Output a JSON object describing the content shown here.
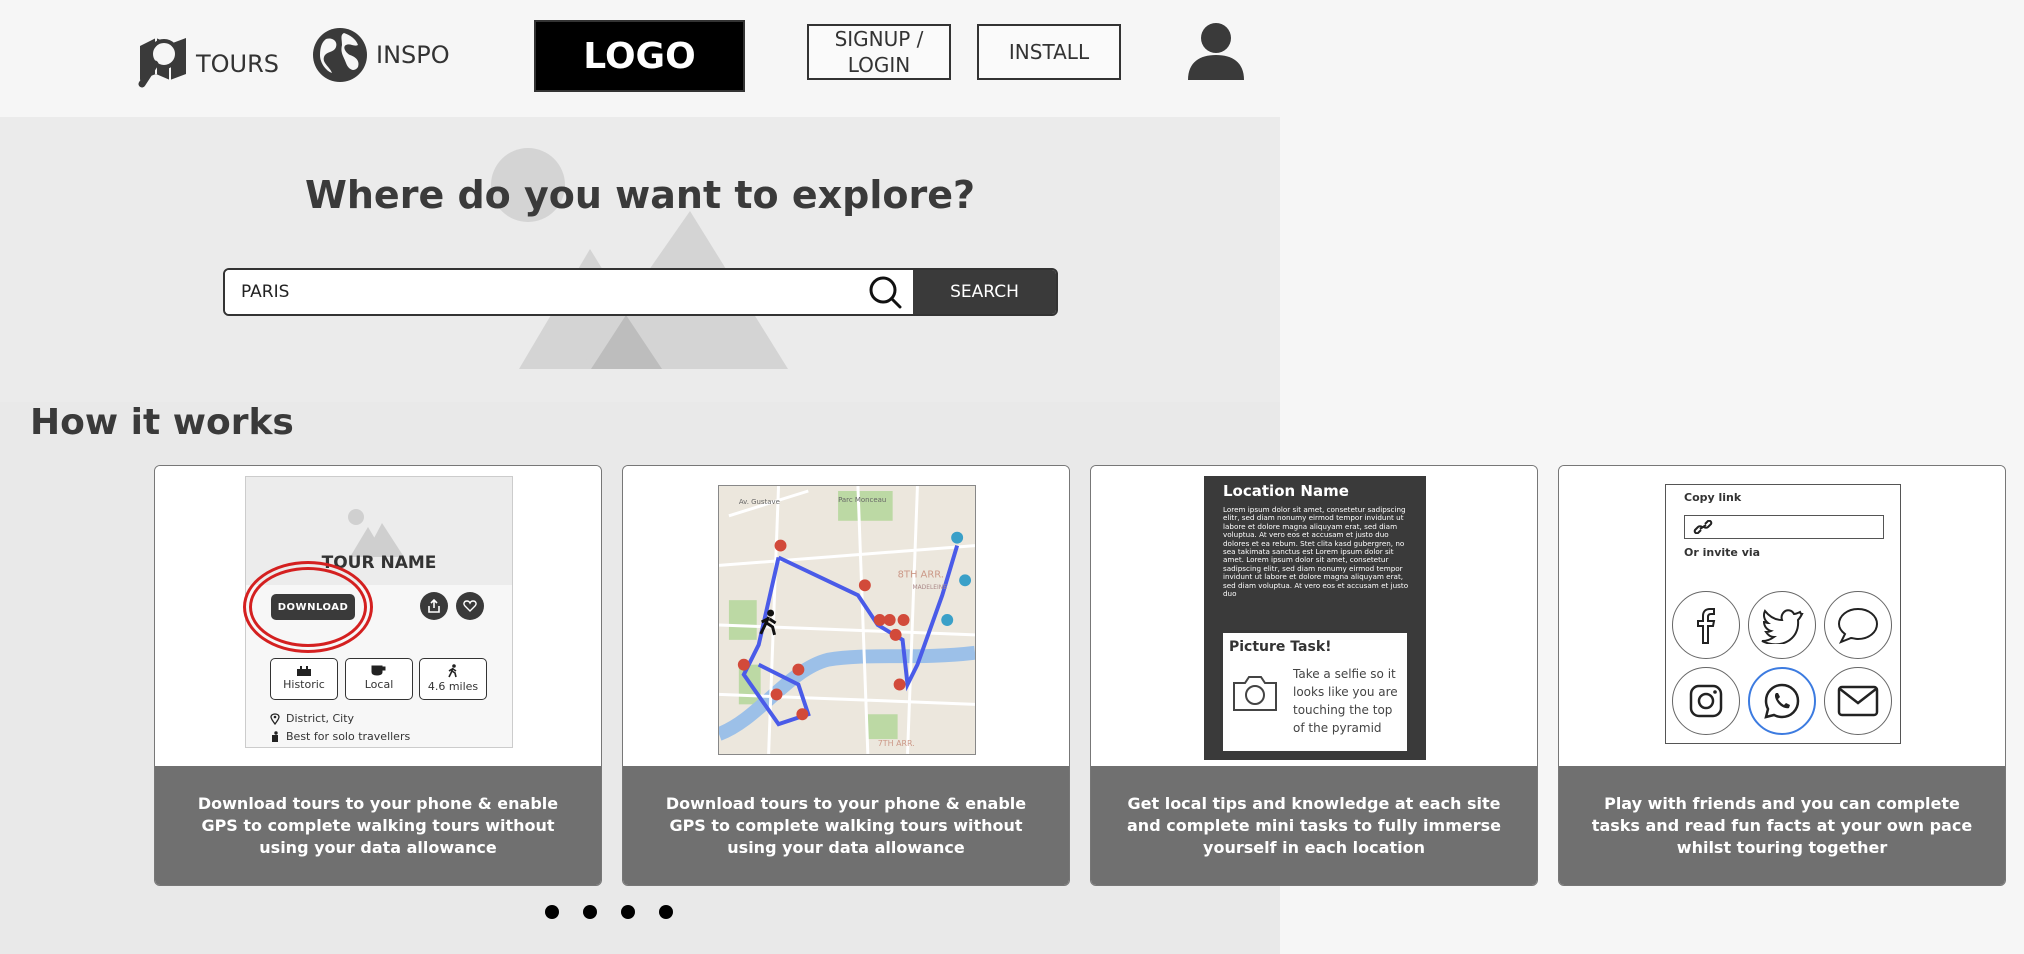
{
  "header": {
    "nav": [
      {
        "label": "TOURS",
        "icon": "map-magnifier-icon"
      },
      {
        "label": "INSPO",
        "icon": "globe-icon"
      }
    ],
    "logo": "LOGO",
    "signup_label": "SIGNUP / LOGIN",
    "install_label": "INSTALL",
    "user_icon": "user-icon"
  },
  "hero": {
    "title": "Where do you want to explore?",
    "search_value": "PARIS",
    "search_button": "SEARCH"
  },
  "how": {
    "title": "How it works",
    "cards": [
      {
        "mock": {
          "tour_name": "TOUR NAME",
          "download": "DOWNLOAD",
          "tags": [
            "Historic",
            "Local",
            "4.6 miles"
          ],
          "location": "District, City",
          "best_for": "Best for solo travellers"
        },
        "caption": "Download tours to your phone & enable GPS to complete walking tours without using your data allowance"
      },
      {
        "map_labels": [
          "Av. Gustave",
          "Parc Monceau",
          "8TH ARR.",
          "MADELEINE",
          "7TH ARR."
        ],
        "caption": "Download tours to your phone & enable GPS to complete walking tours without using your data allowance"
      },
      {
        "mock": {
          "location_name": "Location Name",
          "lorem": "Lorem ipsum dolor sit amet, consetetur sadipscing elitr, sed diam nonumy eirmod tempor invidunt ut labore et dolore magna aliquyam erat, sed diam voluptua. At vero eos et accusam et justo duo dolores et ea rebum. Stet clita kasd gubergren, no sea takimata sanctus est Lorem ipsum dolor sit amet. Lorem ipsum dolor sit amet, consetetur sadipscing elitr, sed diam nonumy eirmod tempor invidunt ut labore et dolore magna aliquyam erat, sed diam voluptua. At vero eos et accusam et justo duo",
          "task_title": "Picture Task!",
          "task_text": "Take a selfie so it looks like you are touching the top of the pyramid"
        },
        "caption": "Get local tips and knowledge at each site and complete mini tasks to fully immerse yourself in each location"
      },
      {
        "mock": {
          "copy_link": "Copy link",
          "invite_via": "Or invite via",
          "socials": [
            "facebook-icon",
            "twitter-icon",
            "chat-bubble-icon",
            "instagram-icon",
            "whatsapp-icon",
            "mail-icon"
          ]
        },
        "caption": "Play with friends and you can complete tasks and read fun facts at your own pace whilst touring together"
      }
    ],
    "carousel_dots": 4
  },
  "colors": {
    "dark": "#3a3a3a",
    "caption_bg": "#707070",
    "highlight_red": "#d42020",
    "route_blue": "#4a5be8",
    "selected_blue": "#3c7be0"
  }
}
